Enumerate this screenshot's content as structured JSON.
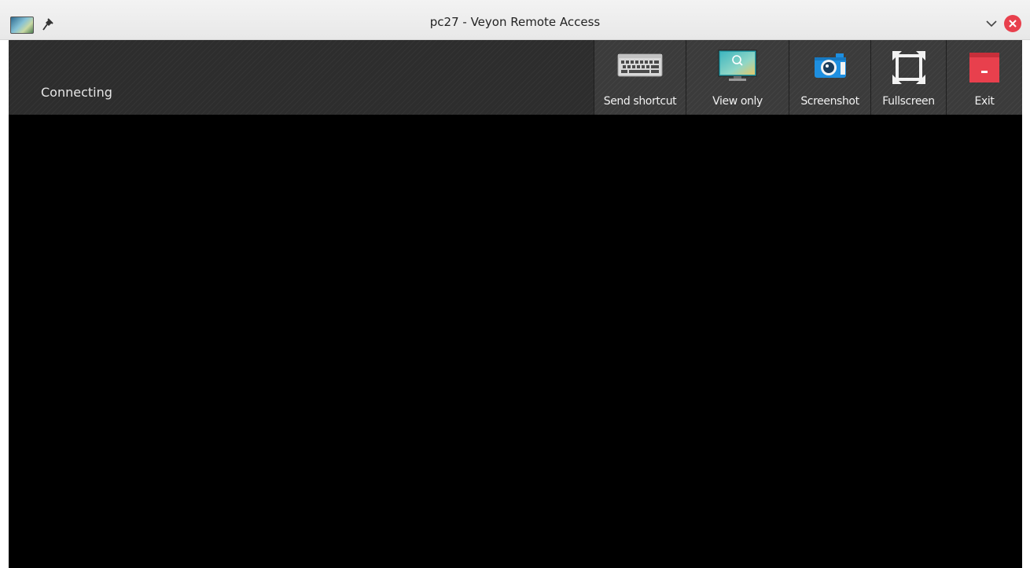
{
  "window": {
    "title": "pc27 - Veyon Remote Access"
  },
  "titlebar": {
    "icons": {
      "app": "remote-desktop-icon",
      "pin": "pin-icon",
      "minimize": "chevron-down-icon",
      "close": "close-icon"
    }
  },
  "status": {
    "text": "Connecting"
  },
  "toolbar": {
    "buttons": [
      {
        "label": "Send shortcut",
        "icon": "keyboard-icon"
      },
      {
        "label": "View only",
        "icon": "monitor-search-icon"
      },
      {
        "label": "Screenshot",
        "icon": "camera-icon"
      },
      {
        "label": "Fullscreen",
        "icon": "fullscreen-icon"
      },
      {
        "label": "Exit",
        "icon": "exit-window-icon"
      }
    ]
  },
  "colors": {
    "toolbar_bg": "#2d2d2d",
    "remote_view_bg": "#000000",
    "close_button": "#e8404d",
    "exit_accent": "#e8404d",
    "screenshot_accent": "#1e8fe0"
  }
}
